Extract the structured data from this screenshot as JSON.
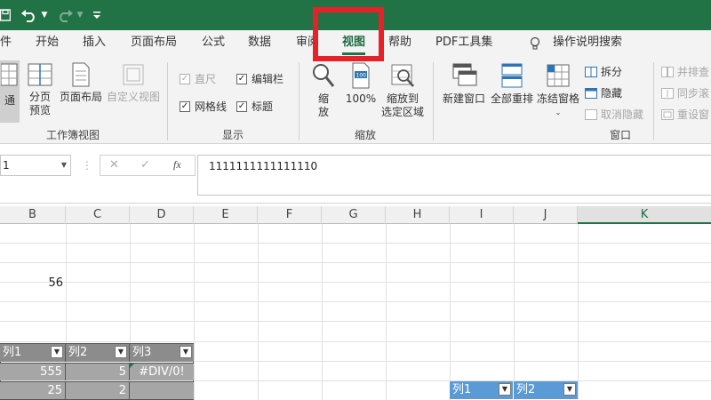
{
  "colors": {
    "brand": "#217346",
    "highlight": "#e62129",
    "table_header": "#8c8c8c",
    "table_body": "#a6a6a6",
    "table2_header": "#5b9bd5"
  },
  "quick_access": {
    "save_icon": "save-icon",
    "undo_icon": "undo-icon",
    "redo_icon": "redo-icon",
    "customize_icon": "customize-icon"
  },
  "tabs": [
    {
      "label": "件"
    },
    {
      "label": "开始"
    },
    {
      "label": "插入"
    },
    {
      "label": "页面布局"
    },
    {
      "label": "公式"
    },
    {
      "label": "数据"
    },
    {
      "label": "审阅"
    },
    {
      "label": "视图",
      "active": true
    },
    {
      "label": "帮助"
    },
    {
      "label": "PDF工具集"
    },
    {
      "label": "操作说明搜索"
    }
  ],
  "ribbon": {
    "workbook_views": {
      "group_label": "工作簿视图",
      "normal": "通",
      "page_break_1": "分页",
      "page_break_2": "预览",
      "page_layout": "页面布局",
      "custom_views": "自定义视图"
    },
    "show": {
      "group_label": "显示",
      "ruler": "直尺",
      "formula_bar": "编辑栏",
      "gridlines": "网格线",
      "headings": "标题"
    },
    "zoom": {
      "group_label": "缩放",
      "zoom_1": "缩",
      "zoom_2": "放",
      "hundred": "100%",
      "to_selection_1": "缩放到",
      "to_selection_2": "选定区域"
    },
    "window": {
      "group_label": "窗口",
      "new_window": "新建窗口",
      "arrange_all": "全部重排",
      "freeze_panes": "冻结窗格",
      "split": "拆分",
      "hide": "隐藏",
      "unhide": "取消隐藏",
      "side_by_side": "并排查",
      "sync_scroll": "同步滚",
      "reset_position": "重设窗"
    }
  },
  "formula_bar": {
    "name_box": "1",
    "formula": "1111111111111110",
    "fx": "fx",
    "cancel": "✕",
    "enter": "✓"
  },
  "grid": {
    "columns": [
      "B",
      "C",
      "D",
      "E",
      "F",
      "G",
      "H",
      "I",
      "J",
      "K"
    ],
    "selected_column": "K",
    "b_value": "56",
    "table1": {
      "headers": [
        "列1",
        "列2",
        "列3"
      ],
      "rows": [
        [
          "555",
          "5",
          "#DIV/0!"
        ],
        [
          "25",
          "2",
          ""
        ]
      ]
    },
    "table2": {
      "headers": [
        "列1",
        "列2"
      ]
    }
  }
}
